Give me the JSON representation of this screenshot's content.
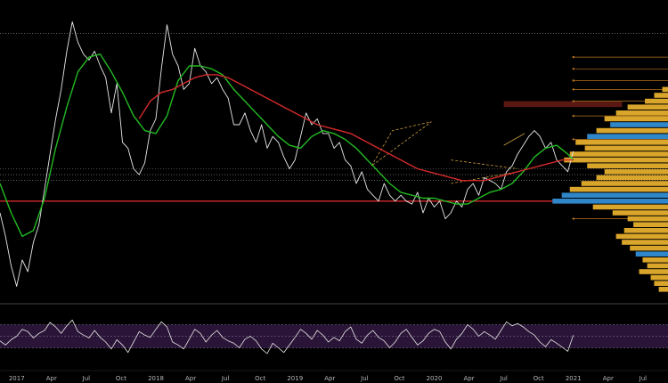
{
  "chart_data": [
    {
      "type": "line",
      "panel": "price",
      "title": "",
      "xlabel": "",
      "ylabel": "",
      "x_tick_labels": [
        "2017",
        "Apr",
        "Jul",
        "Oct",
        "2018",
        "Apr",
        "Jul",
        "Oct",
        "2019",
        "Apr",
        "Jul",
        "Oct",
        "2020",
        "Apr",
        "Jul",
        "Oct",
        "2021",
        "Apr",
        "Jul"
      ],
      "x_tick_values": [
        2017.0,
        2017.25,
        2017.5,
        2017.75,
        2018.0,
        2018.25,
        2018.5,
        2018.75,
        2019.0,
        2019.25,
        2019.5,
        2019.75,
        2020.0,
        2020.25,
        2020.5,
        2020.75,
        2021.0,
        2021.25,
        2021.5
      ],
      "xlim": [
        2016.88,
        2021.68
      ],
      "ylim": [
        0,
        100
      ],
      "grid": false,
      "colors": {
        "background": "#000000",
        "price": "#e8e8e8",
        "ma_fast": "#22bb22",
        "ma_slow": "#d42a2a",
        "support": "#d42a2a",
        "resistance_box": "#5a1812",
        "volume_profile": "#d9a52a",
        "volume_profile_hv": "#2f86c8",
        "pattern": "#c79a3c",
        "fib": "#b8741f"
      },
      "series": [
        {
          "role": "price",
          "x": [
            2016.88,
            2016.92,
            2016.96,
            2017.0,
            2017.04,
            2017.08,
            2017.12,
            2017.16,
            2017.2,
            2017.24,
            2017.28,
            2017.32,
            2017.36,
            2017.4,
            2017.44,
            2017.48,
            2017.52,
            2017.56,
            2017.6,
            2017.64,
            2017.68,
            2017.72,
            2017.76,
            2017.8,
            2017.84,
            2017.88,
            2017.92,
            2017.96,
            2018.0,
            2018.04,
            2018.08,
            2018.12,
            2018.16,
            2018.2,
            2018.24,
            2018.28,
            2018.32,
            2018.36,
            2018.4,
            2018.44,
            2018.48,
            2018.52,
            2018.56,
            2018.6,
            2018.64,
            2018.68,
            2018.72,
            2018.76,
            2018.8,
            2018.84,
            2018.88,
            2018.92,
            2018.96,
            2019.0,
            2019.04,
            2019.08,
            2019.12,
            2019.16,
            2019.2,
            2019.24,
            2019.28,
            2019.32,
            2019.36,
            2019.4,
            2019.44,
            2019.48,
            2019.52,
            2019.56,
            2019.6,
            2019.64,
            2019.68,
            2019.72,
            2019.76,
            2019.8,
            2019.84,
            2019.88,
            2019.92,
            2019.96,
            2020.0,
            2020.04,
            2020.08,
            2020.12,
            2020.16,
            2020.2,
            2020.24,
            2020.28,
            2020.32,
            2020.36,
            2020.4,
            2020.44,
            2020.48,
            2020.52,
            2020.56,
            2020.6,
            2020.64,
            2020.68,
            2020.72,
            2020.76,
            2020.8,
            2020.84,
            2020.88,
            2020.92,
            2020.96,
            2021.0
          ],
          "y": [
            30,
            22,
            12,
            5,
            14,
            10,
            20,
            26,
            38,
            50,
            62,
            72,
            85,
            95,
            88,
            84,
            82,
            85,
            80,
            76,
            64,
            74,
            54,
            52,
            45,
            43,
            47,
            58,
            62,
            79,
            94,
            84,
            80,
            72,
            74,
            86,
            80,
            78,
            74,
            76,
            72,
            69,
            60,
            60,
            64,
            58,
            54,
            60,
            52,
            56,
            54,
            49,
            45,
            48,
            56,
            64,
            60,
            62,
            57,
            57,
            52,
            54,
            48,
            46,
            40,
            44,
            38,
            36,
            34,
            40,
            36,
            34,
            36,
            34,
            33,
            37,
            30,
            35,
            32,
            34,
            28,
            30,
            34,
            32,
            38,
            40,
            36,
            42,
            41,
            40,
            38,
            44,
            46,
            50,
            53,
            56,
            58,
            56,
            52,
            54,
            48,
            46,
            44,
            51
          ]
        },
        {
          "role": "ma_fast",
          "x": [
            2016.88,
            2016.96,
            2017.04,
            2017.12,
            2017.2,
            2017.28,
            2017.36,
            2017.44,
            2017.52,
            2017.6,
            2017.68,
            2017.76,
            2017.84,
            2017.92,
            2018.0,
            2018.08,
            2018.16,
            2018.24,
            2018.32,
            2018.4,
            2018.48,
            2018.56,
            2018.64,
            2018.72,
            2018.8,
            2018.88,
            2018.96,
            2019.04,
            2019.12,
            2019.2,
            2019.28,
            2019.36,
            2019.44,
            2019.52,
            2019.6,
            2019.68,
            2019.76,
            2019.84,
            2019.92,
            2020.0,
            2020.08,
            2020.16,
            2020.24,
            2020.32,
            2020.4,
            2020.48,
            2020.56,
            2020.64,
            2020.72,
            2020.8,
            2020.88,
            2020.96,
            2021.0
          ],
          "y": [
            40,
            30,
            22,
            24,
            35,
            52,
            66,
            78,
            83,
            84,
            78,
            71,
            63,
            58,
            57,
            63,
            75,
            80,
            80,
            79,
            77,
            72,
            68,
            64,
            60,
            56,
            53,
            52,
            56,
            58,
            57,
            55,
            52,
            48,
            44,
            40,
            37,
            36,
            35,
            35,
            34,
            33,
            33,
            35,
            37,
            38,
            40,
            44,
            49,
            52,
            53,
            50,
            48
          ]
        },
        {
          "role": "ma_slow",
          "x": [
            2017.88,
            2017.96,
            2018.04,
            2018.12,
            2018.2,
            2018.28,
            2018.36,
            2018.44,
            2018.52,
            2018.6,
            2018.68,
            2018.76,
            2018.84,
            2018.92,
            2019.0,
            2019.08,
            2019.16,
            2019.24,
            2019.32,
            2019.4,
            2019.48,
            2019.56,
            2019.64,
            2019.72,
            2019.8,
            2019.88,
            2019.96,
            2020.04,
            2020.12,
            2020.2,
            2020.28,
            2020.36,
            2020.44,
            2020.52,
            2020.6,
            2020.68,
            2020.76,
            2020.84,
            2020.92,
            2021.0
          ],
          "y": [
            62,
            68,
            71,
            72,
            74,
            76,
            77,
            77,
            76,
            74,
            72,
            70,
            68,
            66,
            64,
            62,
            60,
            59,
            58,
            57,
            55,
            53,
            51,
            49,
            47,
            45,
            44,
            43,
            42,
            41,
            41,
            41,
            42,
            43,
            44,
            45,
            46,
            47,
            48,
            48
          ]
        }
      ],
      "horizontal_levels": [
        {
          "role": "support",
          "y": 34
        },
        {
          "role": "level",
          "y": 45
        },
        {
          "role": "level",
          "y": 43
        },
        {
          "role": "level",
          "y": 41
        },
        {
          "role": "level",
          "y": 91
        }
      ],
      "resistance_zone": {
        "x_start": 2020.5,
        "x_end": 2021.35,
        "y_low": 66,
        "y_high": 68
      },
      "fib_levels": [
        83,
        79,
        75,
        72,
        68,
        63,
        55,
        28
      ],
      "annotations": [
        {
          "shape": "triangle",
          "x": [
            2019.55,
            2019.7,
            2019.98
          ],
          "y": [
            46,
            58,
            61
          ]
        },
        {
          "shape": "wedge",
          "x": [
            2020.12,
            2020.6
          ],
          "y_top": [
            48,
            45
          ],
          "y_bottom": [
            40,
            44
          ]
        },
        {
          "shape": "trendline",
          "x": [
            2020.5,
            2020.65
          ],
          "y": [
            53,
            57
          ]
        }
      ],
      "volume_profile": {
        "levels": [
          72,
          70,
          68,
          66,
          64,
          62,
          60,
          58,
          56,
          54,
          52,
          50,
          48,
          46,
          44,
          42,
          40,
          38,
          36,
          34,
          32,
          30,
          28,
          26,
          24,
          22,
          20,
          18,
          16,
          14,
          12,
          10,
          8,
          6,
          4
        ],
        "values": [
          5,
          12,
          20,
          35,
          45,
          55,
          50,
          62,
          70,
          80,
          72,
          85,
          90,
          70,
          55,
          62,
          75,
          85,
          92,
          100,
          65,
          48,
          35,
          30,
          38,
          45,
          40,
          33,
          28,
          22,
          18,
          25,
          15,
          12,
          8
        ],
        "highlighted_levels": [
          60,
          56,
          36,
          34,
          16
        ]
      }
    },
    {
      "type": "line",
      "panel": "oscillator",
      "title": "",
      "ylim": [
        0,
        100
      ],
      "band": [
        30,
        70
      ],
      "reference_levels": [
        30,
        50,
        70
      ],
      "series": [
        {
          "role": "oscillator",
          "x": [
            2016.88,
            2016.92,
            2016.96,
            2017.0,
            2017.04,
            2017.08,
            2017.12,
            2017.16,
            2017.2,
            2017.24,
            2017.28,
            2017.32,
            2017.36,
            2017.4,
            2017.44,
            2017.48,
            2017.52,
            2017.56,
            2017.6,
            2017.64,
            2017.68,
            2017.72,
            2017.76,
            2017.8,
            2017.84,
            2017.88,
            2017.92,
            2017.96,
            2018.0,
            2018.04,
            2018.08,
            2018.12,
            2018.16,
            2018.2,
            2018.24,
            2018.28,
            2018.32,
            2018.36,
            2018.4,
            2018.44,
            2018.48,
            2018.52,
            2018.56,
            2018.6,
            2018.64,
            2018.68,
            2018.72,
            2018.76,
            2018.8,
            2018.84,
            2018.88,
            2018.92,
            2018.96,
            2019.0,
            2019.04,
            2019.08,
            2019.12,
            2019.16,
            2019.2,
            2019.24,
            2019.28,
            2019.32,
            2019.36,
            2019.4,
            2019.44,
            2019.48,
            2019.52,
            2019.56,
            2019.6,
            2019.64,
            2019.68,
            2019.72,
            2019.76,
            2019.8,
            2019.84,
            2019.88,
            2019.92,
            2019.96,
            2020.0,
            2020.04,
            2020.08,
            2020.12,
            2020.16,
            2020.2,
            2020.24,
            2020.28,
            2020.32,
            2020.36,
            2020.4,
            2020.44,
            2020.48,
            2020.52,
            2020.56,
            2020.6,
            2020.64,
            2020.68,
            2020.72,
            2020.76,
            2020.8,
            2020.84,
            2020.88,
            2020.96,
            2021.0
          ],
          "y": [
            42,
            35,
            44,
            50,
            62,
            58,
            47,
            55,
            60,
            74,
            66,
            55,
            68,
            78,
            58,
            52,
            47,
            60,
            48,
            40,
            28,
            44,
            35,
            22,
            40,
            58,
            52,
            48,
            62,
            75,
            66,
            40,
            35,
            28,
            45,
            62,
            55,
            40,
            52,
            60,
            48,
            42,
            38,
            30,
            45,
            50,
            42,
            28,
            20,
            38,
            30,
            22,
            35,
            48,
            62,
            55,
            45,
            60,
            52,
            40,
            48,
            42,
            58,
            66,
            45,
            38,
            52,
            60,
            48,
            42,
            30,
            40,
            55,
            62,
            48,
            35,
            42,
            55,
            62,
            58,
            40,
            28,
            45,
            55,
            70,
            62,
            50,
            58,
            52,
            45,
            60,
            75,
            68,
            72,
            66,
            58,
            52,
            40,
            32,
            44,
            38,
            24,
            52
          ]
        }
      ]
    }
  ]
}
